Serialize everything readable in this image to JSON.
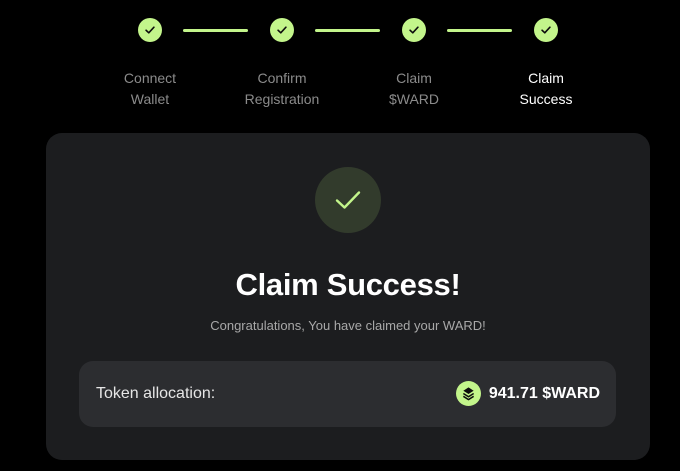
{
  "stepper": {
    "steps": [
      {
        "line1": "Connect",
        "line2": "Wallet",
        "status": "done"
      },
      {
        "line1": "Confirm",
        "line2": "Registration",
        "status": "done"
      },
      {
        "line1": "Claim",
        "line2": "$WARD",
        "status": "done"
      },
      {
        "line1": "Claim",
        "line2": "Success",
        "status": "active"
      }
    ],
    "icon": "check-icon"
  },
  "card": {
    "badge_icon": "check-icon",
    "title": "Claim Success!",
    "subtitle": "Congratulations, You have claimed your WARD!",
    "allocation": {
      "label": "Token allocation:",
      "token_icon": "ward-token-icon",
      "amount": "941.71 $WARD"
    }
  },
  "colors": {
    "accent": "#c3f58b",
    "background": "#000000",
    "card": "#1c1d1f",
    "panel": "#2c2d30",
    "muted_text": "#8b8b8b"
  }
}
